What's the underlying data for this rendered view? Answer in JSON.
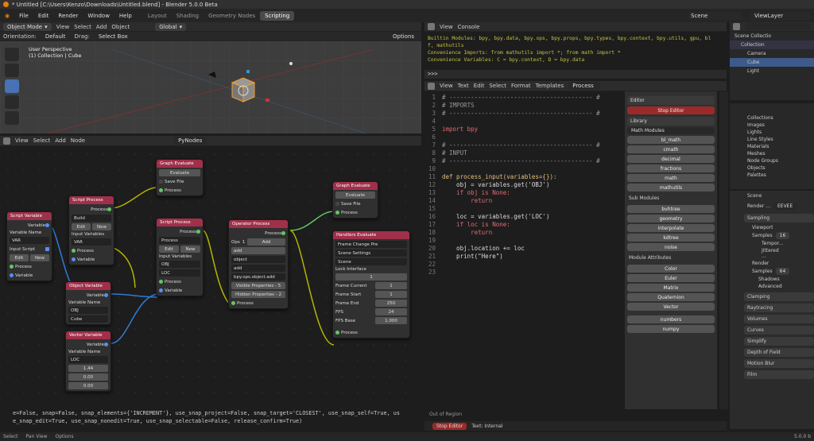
{
  "titlebar": {
    "title": "* Untitled [C:\\Users\\Kenzo\\Downloads\\Untitled.blend] - Blender 5.0.0 Beta"
  },
  "menu": {
    "items": [
      "File",
      "Edit",
      "Render",
      "Window",
      "Help"
    ],
    "workspaces": [
      "Layout",
      "Shading",
      "Geometry Nodes",
      "Scripting"
    ],
    "active": "Scripting",
    "scene": "Scene",
    "view_layer": "ViewLayer"
  },
  "viewport": {
    "mode": "Object Mode",
    "menus": [
      "View",
      "Select",
      "Add",
      "Object"
    ],
    "orientation_label": "Orientation:",
    "orientation": "Default",
    "drag_label": "Drag:",
    "drag": "Select Box",
    "transform": "Global",
    "options": "Options",
    "info1": "User Perspective",
    "info2": "(1) Collection | Cube"
  },
  "nodeeditor": {
    "menus": [
      "View",
      "Select",
      "Add",
      "Node"
    ],
    "tree": "PyNodes",
    "log1": "e=False, snap=False, snap_elements={'INCREMENT'}, use_snap_project=False, snap_target='CLOSEST', use_snap_self=True, us",
    "log2": "e_snap_edit=True, use_snap_nonedit=True, use_snap_selectable=False, release_confirm=True)"
  },
  "nodes": {
    "script_variable": {
      "title": "Script Variable",
      "out": "Variable",
      "name_label": "Variable Name",
      "name": "VAR",
      "input": "Input Script",
      "edit": "Edit",
      "new": "New",
      "process": "Process",
      "variable": "Variable"
    },
    "script_process1": {
      "title": "Script Process",
      "out": "Process",
      "build": "Build",
      "edit": "Edit",
      "new": "New",
      "inputs": "Input Variables",
      "var": "VAR",
      "process": "Process",
      "variable": "Variable"
    },
    "object_variable": {
      "title": "Object Variable",
      "out": "Variable",
      "name_label": "Variable Name",
      "name": "OBJ",
      "obj": "Cube"
    },
    "vector_variable": {
      "title": "Vector Variable",
      "out": "Variable",
      "name_label": "Variable Name",
      "name": "LOC",
      "v1": "1.44",
      "v2": "0.00",
      "v3": "0.00"
    },
    "graph_eval1": {
      "title": "Graph Evaluate",
      "evaluate": "Evaluate",
      "save": "Save File",
      "process": "Process"
    },
    "script_process2": {
      "title": "Script Process",
      "out": "Process",
      "process_label": "Process",
      "edit": "Edit",
      "new": "New",
      "inputs": "Input Variables",
      "v1": "OBJ",
      "v2": "LOC",
      "process": "Process",
      "variable": "Variable"
    },
    "operator_process": {
      "title": "Operator Process",
      "out": "Process",
      "ops": "Ops",
      "ops_n": "1",
      "add": "Add",
      "a1": "add",
      "a2": "object",
      "a3": "add",
      "op": "bpy.ops.object.add",
      "visible": "Visible Properties - 5",
      "hidden": "Hidden Properties - 2",
      "process": "Process"
    },
    "graph_eval2": {
      "title": "Graph Evaluate",
      "evaluate": "Evaluate",
      "save": "Save File",
      "process": "Process"
    },
    "handlers": {
      "title": "Handlers Evaluate",
      "handler": "Frame Change Pre",
      "scene_settings": "Scene Settings",
      "scene": "Scene",
      "lock": "Lock Interface",
      "frame_step": "1",
      "fc_label": "Frame Current",
      "fc": "1",
      "fs_label": "Frame Start",
      "fs": "1",
      "fe_label": "Frame End",
      "fe": "250",
      "fps_label": "FPS",
      "fps": "24",
      "fpsb_label": "FPS Base",
      "fpsb": "1.000",
      "process": "Process"
    }
  },
  "console": {
    "menus": [
      "View",
      "Console"
    ],
    "l1": "Builtin Modules:       bpy, bpy.data, bpy.ops, bpy.props, bpy.types, bpy.context, bpy.utils, gpu, bl",
    "l2": "f, mathutils",
    "l3": "Convenience Imports:   from mathutils import *; from math import *",
    "l4": "Convenience Variables: C = bpy.context, D = bpy.data",
    "prompt": ">>>"
  },
  "texteditor": {
    "menus": [
      "View",
      "Text",
      "Edit",
      "Select",
      "Format",
      "Templates"
    ],
    "file": "Process",
    "out_of_region": "Out of Region",
    "stop": "Stop Editor",
    "text_internal": "Text: Internal"
  },
  "sidepanel": {
    "editor": "Editor",
    "stop_editor": "Stop Editor",
    "library": "Library",
    "math_modules": "Math Modules",
    "modules": [
      "bl_math",
      "cmath",
      "decimal",
      "fractions",
      "math",
      "mathutils"
    ],
    "sub_modules": "Sub Modules",
    "subs": [
      "bvhtree",
      "geometry",
      "interpolate",
      "kdtree",
      "noise"
    ],
    "module_attrs": "Module Attributes",
    "attrs": [
      "Color",
      "Euler",
      "Matrix",
      "Quaternion",
      "Vector"
    ],
    "extra": [
      "numbers",
      "numpy"
    ]
  },
  "outliner": {
    "scene_collection": "Scene Collectio",
    "collection": "Collection",
    "camera": "Camera",
    "cube": "Cube",
    "light": "Light"
  },
  "blendfile": {
    "items": [
      "Collections",
      "Images",
      "Lights",
      "Line Styles",
      "Materials",
      "Meshes",
      "Node Groups",
      "Objects",
      "Palettes"
    ]
  },
  "properties": {
    "scene": "Scene",
    "render_label": "Render ...",
    "engine": "EEVEE",
    "sampling": "Sampling",
    "viewport": "Viewport",
    "samples_label": "Samples",
    "vp_samples": "16",
    "temporal": "Tempor...",
    "jittered": "Jittered ...",
    "render": "Render",
    "render_samples": "64",
    "shadows": "Shadows",
    "advanced": "Advanced",
    "clamping": "Clamping",
    "raytracing": "Raytracing",
    "volumes": "Volumes",
    "curves": "Curves",
    "simplify": "Simplify",
    "dof": "Depth of Field",
    "motion_blur": "Motion Blur",
    "film": "Film"
  },
  "status": {
    "select": "Select",
    "pan": "Pan View",
    "options": "Options",
    "version": "5.0.0 b"
  },
  "code": [
    {
      "n": "1",
      "t": "# ---------------------------------------- #",
      "c": "cm"
    },
    {
      "n": "2",
      "t": "# IMPORTS",
      "c": "cm"
    },
    {
      "n": "3",
      "t": "# ---------------------------------------- #",
      "c": "cm"
    },
    {
      "n": "4",
      "t": "",
      "c": "tx"
    },
    {
      "n": "5",
      "t": "import bpy",
      "c": "kw"
    },
    {
      "n": "6",
      "t": "",
      "c": "tx"
    },
    {
      "n": "7",
      "t": "# ---------------------------------------- #",
      "c": "cm"
    },
    {
      "n": "8",
      "t": "# INPUT",
      "c": "cm"
    },
    {
      "n": "9",
      "t": "# ---------------------------------------- #",
      "c": "cm"
    },
    {
      "n": "10",
      "t": "",
      "c": "tx"
    },
    {
      "n": "11",
      "t": "def process_input(variables={}):",
      "c": "fn"
    },
    {
      "n": "12",
      "t": "    obj = variables.get('OBJ')",
      "c": "tx"
    },
    {
      "n": "13",
      "t": "    if obj is None:",
      "c": "kw"
    },
    {
      "n": "14",
      "t": "        return",
      "c": "kw"
    },
    {
      "n": "15",
      "t": "",
      "c": "tx"
    },
    {
      "n": "16",
      "t": "    loc = variables.get('LOC')",
      "c": "tx"
    },
    {
      "n": "17",
      "t": "    if loc is None:",
      "c": "kw"
    },
    {
      "n": "18",
      "t": "        return",
      "c": "kw"
    },
    {
      "n": "19",
      "t": "",
      "c": "tx"
    },
    {
      "n": "20",
      "t": "    obj.location += loc",
      "c": "tx"
    },
    {
      "n": "21",
      "t": "    print(\"Here\")",
      "c": "tx"
    },
    {
      "n": "22",
      "t": "",
      "c": "tx"
    },
    {
      "n": "23",
      "t": "",
      "c": "tx"
    }
  ]
}
